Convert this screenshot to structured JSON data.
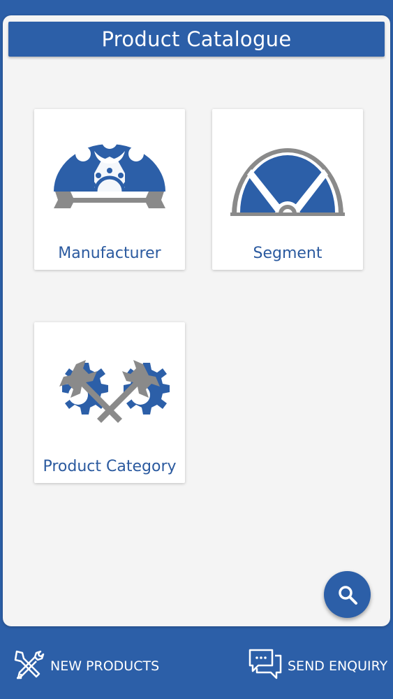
{
  "header": {
    "title": "Product Catalogue"
  },
  "tiles": [
    {
      "label": "Manufacturer",
      "icon": "gear-wrench-icon"
    },
    {
      "label": "Segment",
      "icon": "steering-wheel-icon"
    },
    {
      "label": "Product Category",
      "icon": "crossed-wrenches-gears-icon"
    }
  ],
  "fab": {
    "icon": "search-icon"
  },
  "bottom_nav": {
    "new_products": {
      "label": "NEW PRODUCTS",
      "icon": "tools-icon"
    },
    "send_enquiry": {
      "label": "SEND ENQUIRY",
      "icon": "chat-bubbles-icon"
    }
  },
  "colors": {
    "primary": "#2c5fa8",
    "icon_gray": "#8a8a8a",
    "panel_bg": "#f4f4f4"
  }
}
